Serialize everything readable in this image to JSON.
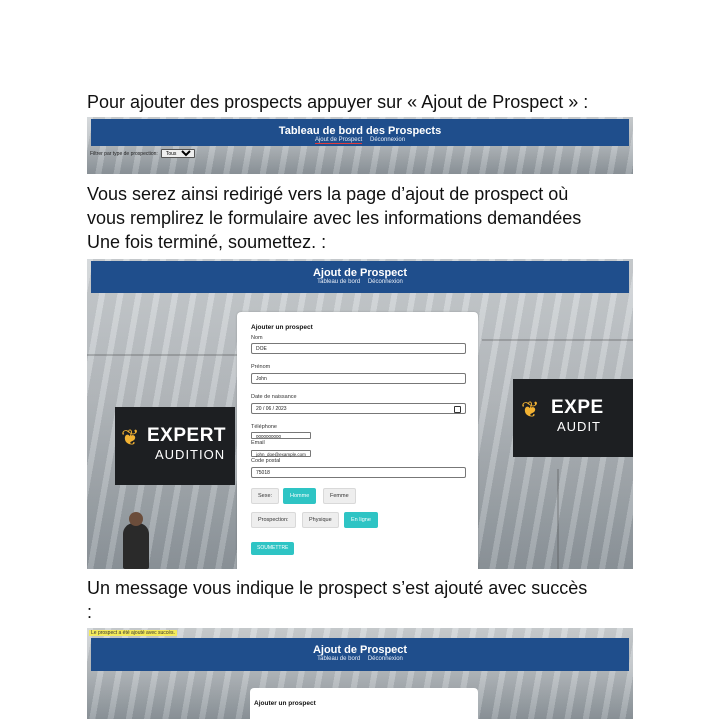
{
  "paragraphs": {
    "p1": "Pour ajouter des prospects appuyer sur « Ajout de Prospect » :",
    "p2_line1": "Vous serez ainsi redirigé vers la page d’ajout de prospect où",
    "p2_line2": "vous remplirez le formulaire avec les informations demandées",
    "p2_line3": "Une fois terminé, soumettez. :",
    "p3_line1": "Un message vous indique le prospect s’est ajouté avec succès",
    "p3_line2": ":"
  },
  "shot1": {
    "title": "Tableau de bord des Prospects",
    "nav": [
      "Ajout de Prospect",
      "Déconnexion"
    ],
    "filter_label": "Filtrer par type de prospection:",
    "filter_value": "Tous"
  },
  "shot2": {
    "title": "Ajout de Prospect",
    "nav": [
      "Tableau de bord",
      "Déconnexion"
    ],
    "storefront_left": {
      "line1": "EXPERT",
      "line2": "AUDITION"
    },
    "storefront_right": {
      "line1": "EXPE",
      "line2": "AUDIT"
    },
    "form": {
      "title": "Ajouter un prospect",
      "nom_label": "Nom",
      "nom_value": "DOE",
      "prenom_label": "Prénom",
      "prenom_value": "John",
      "naissance_label": "Date de naissance",
      "naissance_value": "20 / 06 / 2023",
      "telephone_label": "Téléphone",
      "telephone_value": "0000000000",
      "email_label": "Email",
      "email_value": "john_doe@example.com",
      "cp_label": "Code postal",
      "cp_value": "75018",
      "sexe_label": "Sexe:",
      "sexe_options": [
        "Homme",
        "Femme"
      ],
      "prospection_label": "Prospection:",
      "prospection_options": [
        "Physique",
        "En ligne"
      ],
      "submit_label": "SOUMETTRE"
    }
  },
  "shot3": {
    "success_message": "Le prospect a été ajouté avec succès.",
    "title": "Ajout de Prospect",
    "nav": [
      "Tableau de bord",
      "Déconnexion"
    ],
    "form_title": "Ajouter un prospect"
  },
  "colors": {
    "banner": "#1f4e8c",
    "accent": "#2ec4c4",
    "highlight": "#f4ea5a"
  }
}
